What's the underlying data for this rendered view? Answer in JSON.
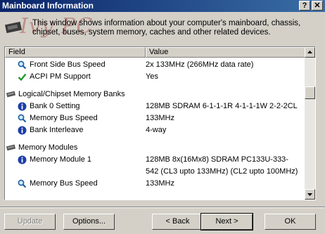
{
  "window": {
    "title": "Mainboard Information",
    "help_glyph": "?",
    "close_glyph": "✕"
  },
  "description": "This window shows information about your computer's mainboard, chassis, chipset, buses, system memory, caches and other related devices.",
  "watermark": "Ivy PC",
  "columns": {
    "field": "Field",
    "value": "Value"
  },
  "rows": [
    {
      "kind": "item",
      "icon": "magnifier-icon",
      "field": "Front Side Bus Speed",
      "value": "2x 133MHz (266MHz data rate)"
    },
    {
      "kind": "item",
      "icon": "checkmark-icon",
      "field": "ACPI PM Support",
      "value": "Yes"
    },
    {
      "kind": "group",
      "icon": "memory-chip-icon",
      "field": "Logical/Chipset Memory Banks",
      "value": ""
    },
    {
      "kind": "item",
      "icon": "info-icon",
      "field": "Bank 0 Setting",
      "value": "128MB SDRAM 6-1-1-1R 4-1-1-1W 2-2-2CL"
    },
    {
      "kind": "item",
      "icon": "magnifier-icon",
      "field": "Memory Bus Speed",
      "value": "133MHz"
    },
    {
      "kind": "item",
      "icon": "info-icon",
      "field": "Bank Interleave",
      "value": "4-way"
    },
    {
      "kind": "group",
      "icon": "memory-chip-icon",
      "field": "Memory Modules",
      "value": ""
    },
    {
      "kind": "item",
      "icon": "info-icon",
      "field": "Memory Module 1",
      "value": "128MB 8x(16Mx8) SDRAM PC133U-333-"
    },
    {
      "kind": "cont",
      "icon": "",
      "field": "",
      "value": "542 (CL3 upto 133MHz) (CL2 upto 100MHz)"
    },
    {
      "kind": "item",
      "icon": "magnifier-icon",
      "field": "Memory Bus Speed",
      "value": "133MHz"
    }
  ],
  "buttons": {
    "update": "Update",
    "options": "Options...",
    "back": "< Back",
    "next": "Next >",
    "ok": "OK"
  }
}
